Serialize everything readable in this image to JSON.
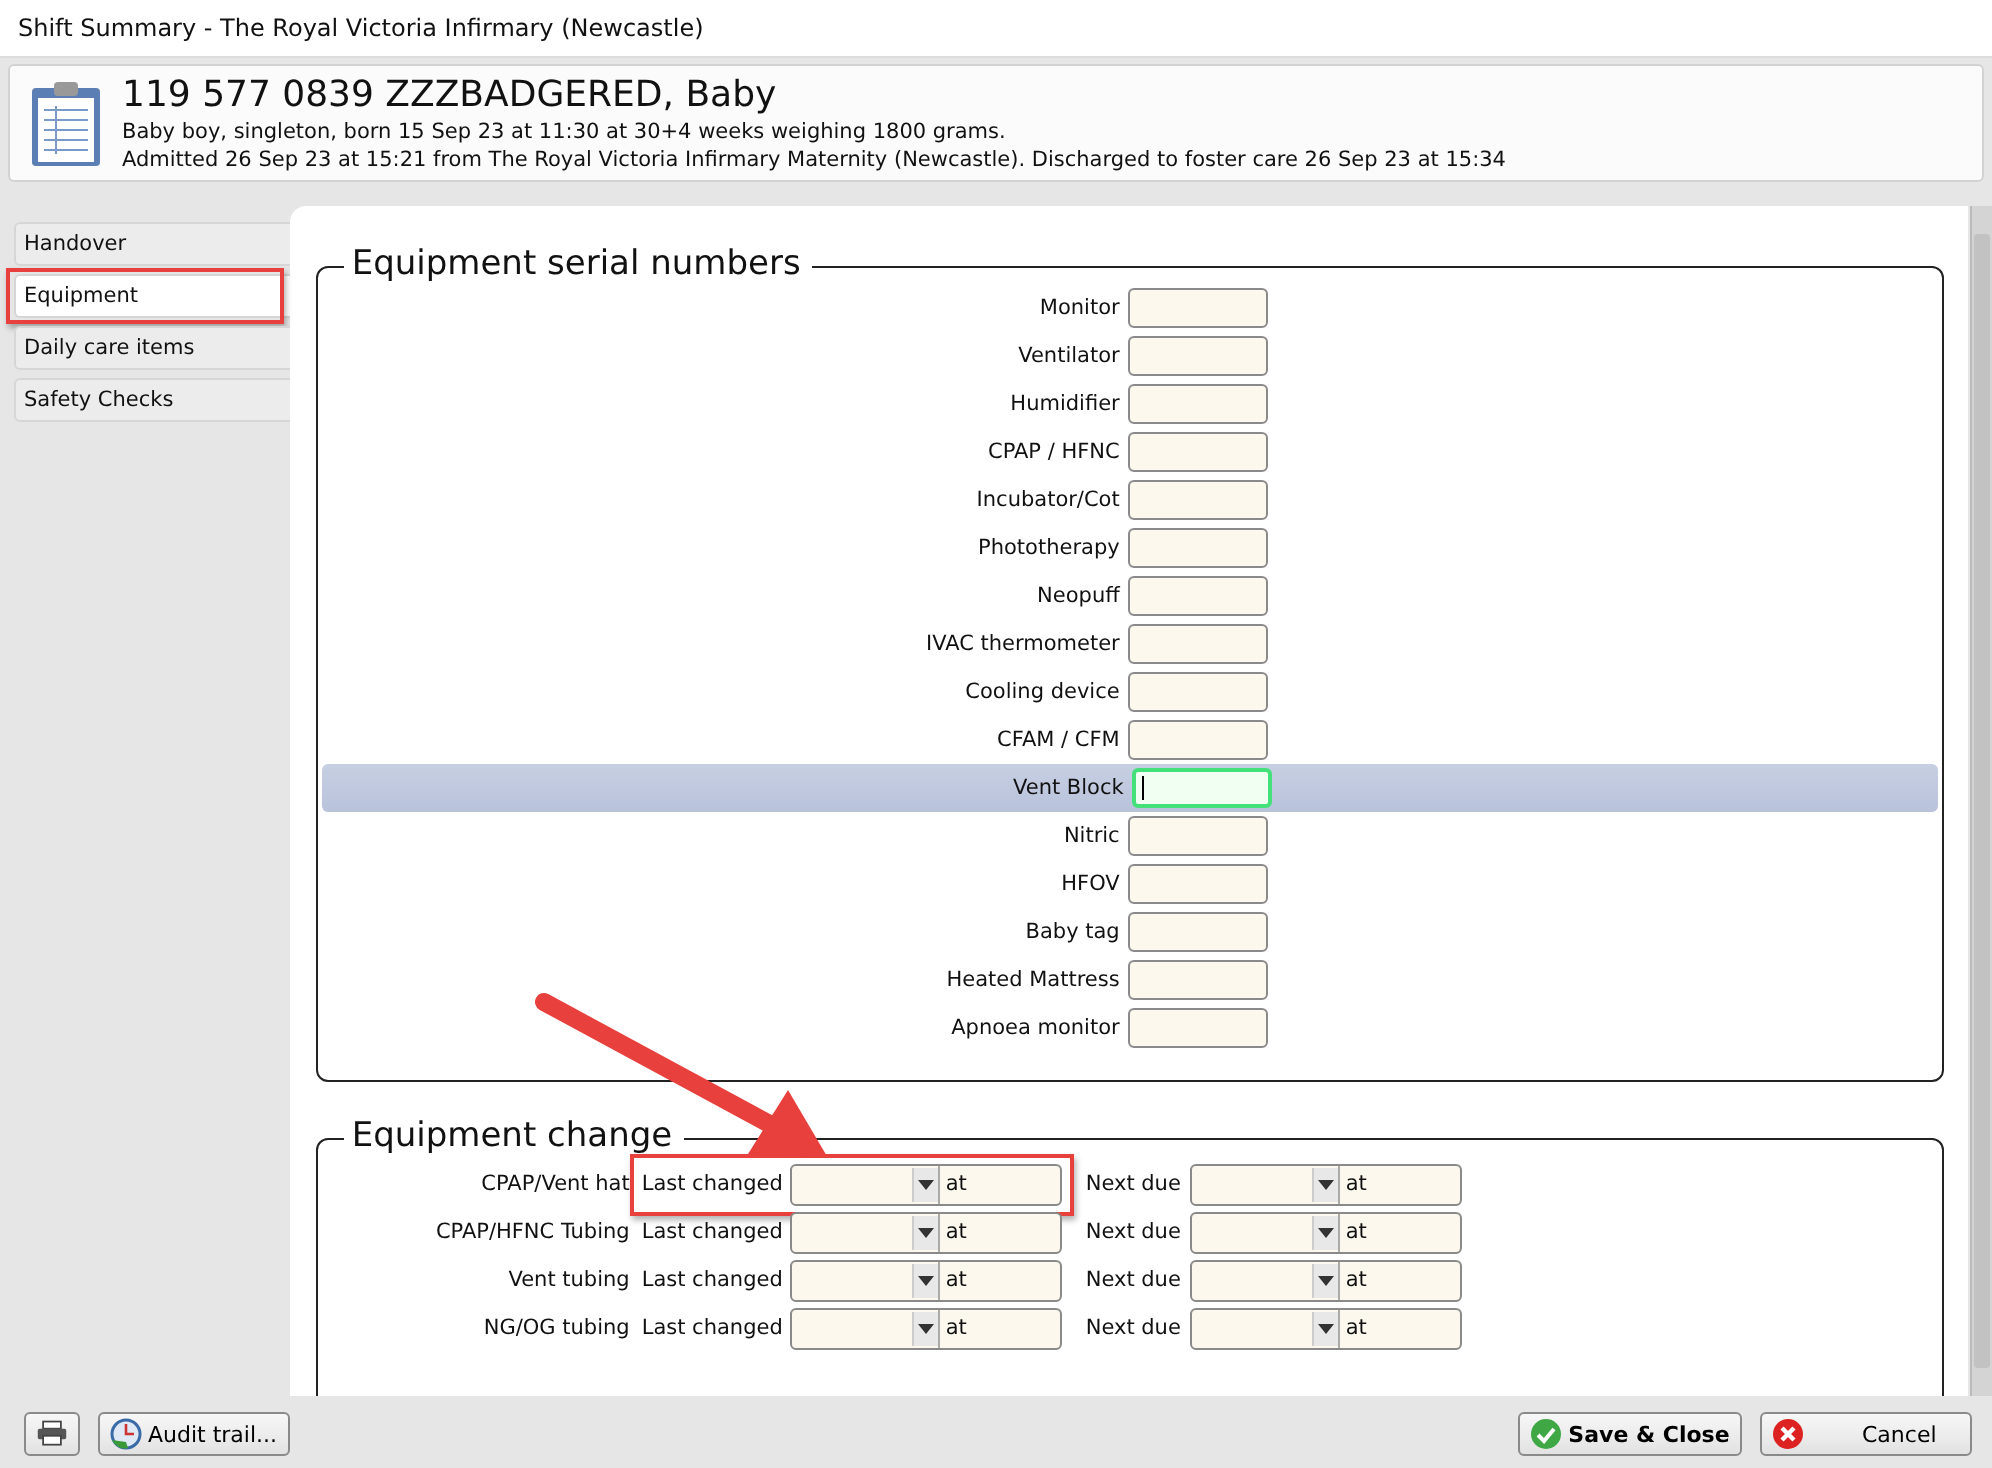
{
  "window": {
    "title": "Shift Summary - The Royal Victoria Infirmary (Newcastle)"
  },
  "patient": {
    "name": "119 577 0839 ZZZBADGERED, Baby",
    "details": "Baby boy, singleton, born 15 Sep 23 at 11:30 at 30+4 weeks weighing 1800 grams.",
    "admission": "Admitted 26 Sep 23 at 15:21 from The Royal Victoria Infirmary Maternity (Newcastle).  Discharged to foster care 26 Sep 23 at 15:34"
  },
  "sidebar": {
    "items": [
      {
        "label": "Handover",
        "selected": false,
        "highlighted": false
      },
      {
        "label": "Equipment",
        "selected": true,
        "highlighted": true
      },
      {
        "label": "Daily care items",
        "selected": false,
        "highlighted": false
      },
      {
        "label": "Safety Checks",
        "selected": false,
        "highlighted": false
      }
    ]
  },
  "serial_numbers": {
    "title": "Equipment serial numbers",
    "rows": [
      {
        "label": "Monitor",
        "focused": false
      },
      {
        "label": "Ventilator",
        "focused": false
      },
      {
        "label": "Humidifier",
        "focused": false
      },
      {
        "label": "CPAP / HFNC",
        "focused": false
      },
      {
        "label": "Incubator/Cot",
        "focused": false
      },
      {
        "label": "Phototherapy",
        "focused": false
      },
      {
        "label": "Neopuff",
        "focused": false
      },
      {
        "label": "IVAC thermometer",
        "focused": false
      },
      {
        "label": "Cooling device",
        "focused": false
      },
      {
        "label": "CFAM / CFM",
        "focused": false
      },
      {
        "label": "Vent Block",
        "focused": true
      },
      {
        "label": "Nitric",
        "focused": false
      },
      {
        "label": "HFOV",
        "focused": false
      },
      {
        "label": "Baby tag",
        "focused": false
      },
      {
        "label": "Heated Mattress",
        "focused": false
      },
      {
        "label": "Apnoea monitor",
        "focused": false
      }
    ]
  },
  "equipment_change": {
    "title": "Equipment change",
    "rows": [
      {
        "label": "CPAP/Vent hat",
        "last_changed_label": "Last changed",
        "last_at": "at",
        "next_due_label": "Next due",
        "next_at": "at",
        "highlighted": true
      },
      {
        "label": "CPAP/HFNC Tubing",
        "last_changed_label": "Last changed",
        "last_at": "at",
        "next_due_label": "Next due",
        "next_at": "at",
        "highlighted": false
      },
      {
        "label": "Vent tubing",
        "last_changed_label": "Last changed",
        "last_at": "at",
        "next_due_label": "Next due",
        "next_at": "at",
        "highlighted": false
      },
      {
        "label": "NG/OG tubing",
        "last_changed_label": "Last changed",
        "last_at": "at",
        "next_due_label": "Next due",
        "next_at": "at",
        "highlighted": false
      }
    ]
  },
  "footer": {
    "audit_button": "Audit trail...",
    "save_button": "Save & Close",
    "cancel_button": "Cancel"
  }
}
